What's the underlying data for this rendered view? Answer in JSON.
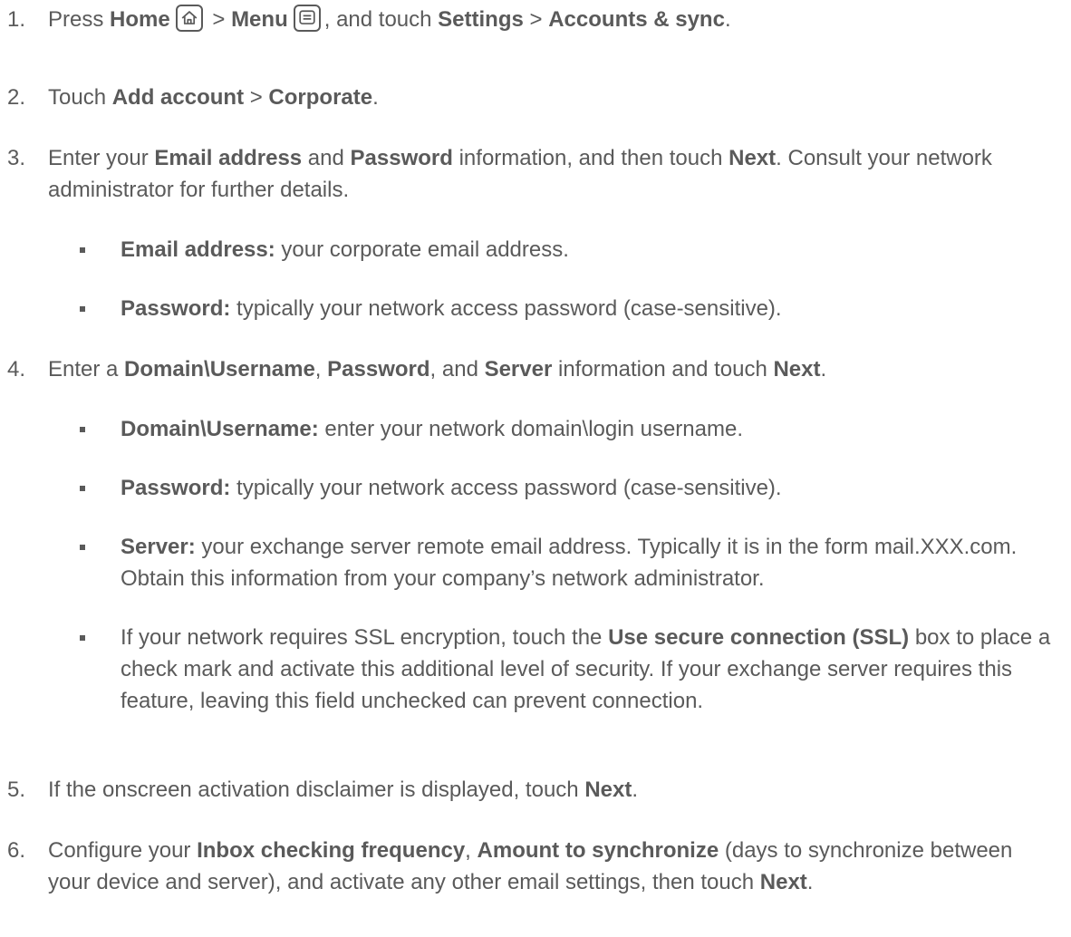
{
  "steps": [
    {
      "num": "1.",
      "seg": [
        "Press ",
        "Home",
        " > ",
        "Menu",
        ", and touch ",
        "Settings",
        " > ",
        "Accounts & sync",
        "."
      ],
      "icons": [
        "home-icon",
        "menu-icon"
      ]
    },
    {
      "num": "2.",
      "seg": [
        "Touch ",
        "Add account",
        " > ",
        "Corporate",
        "."
      ]
    },
    {
      "num": "3.",
      "seg": [
        "Enter your ",
        "Email address",
        " and ",
        "Password",
        " information, and then touch ",
        "Next",
        ". Consult your network administrator for further details."
      ]
    },
    {
      "num": "4.",
      "seg": [
        "Enter a ",
        "Domain\\Username",
        ", ",
        "Password",
        ", and ",
        "Server",
        " information and touch ",
        "Next",
        "."
      ]
    },
    {
      "num": "5.",
      "seg": [
        "If the onscreen activation disclaimer is displayed, touch ",
        "Next",
        "."
      ]
    },
    {
      "num": "6.",
      "seg": [
        "Configure your ",
        "Inbox checking frequency",
        ", ",
        "Amount to synchronize",
        " (days to synchronize between your device and server), and activate any other email settings, then touch ",
        "Next",
        "."
      ]
    }
  ],
  "bullets": [
    {
      "label": "Email address:",
      "text": " your corporate email address."
    },
    {
      "label": "Password:",
      "text": " typically your network access password (case-sensitive)."
    },
    {
      "label": "Domain\\Username:",
      "text": " enter your network domain\\login username."
    },
    {
      "label": "Password:",
      "text": " typically your network access password (case-sensitive)."
    },
    {
      "label": "Server:",
      "text": " your exchange server remote email address. Typically it is in the form mail.XXX.com. Obtain this information from your company’s network administrator."
    },
    {
      "seg": [
        "If your network requires SSL encryption, touch the ",
        "Use secure connection (SSL)",
        " box to place a check mark and activate this additional level of security. If your exchange server requires this feature, leaving this field unchecked can prevent connection."
      ]
    }
  ]
}
